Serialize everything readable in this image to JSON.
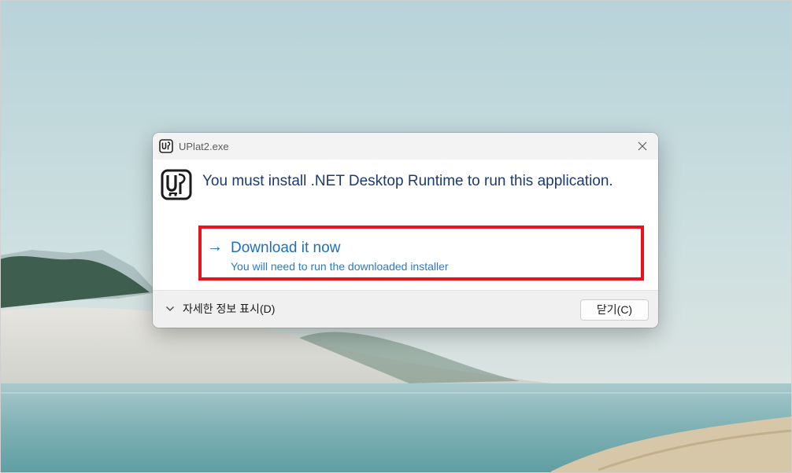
{
  "window": {
    "title": "UPlat2.exe"
  },
  "dialog": {
    "main_instruction": "You must install .NET Desktop Runtime to run this application.",
    "command_link": {
      "arrow": "→",
      "title": "Download it now",
      "subtitle": "You will need to run the downloaded installer"
    },
    "footer": {
      "details_label": "자세한 정보 표시(D)",
      "close_label": "닫기(C)"
    }
  },
  "icons": {
    "app": "uplat-app-icon",
    "close": "close-icon",
    "expand": "chevron-down-icon"
  },
  "colors": {
    "instruction_text": "#1c3a70",
    "link_text": "#1f6fbd",
    "highlight_border": "#e8141b"
  }
}
